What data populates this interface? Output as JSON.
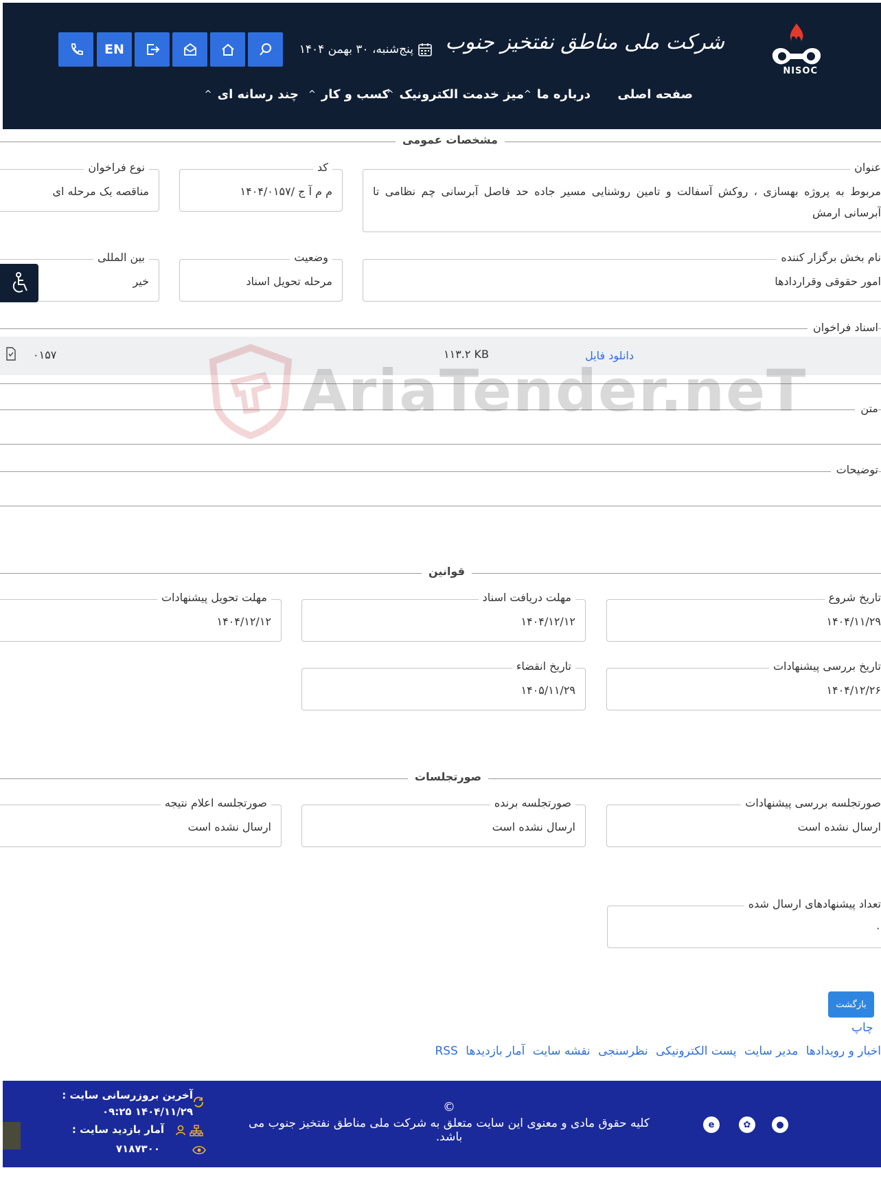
{
  "header": {
    "org_name": "شرکت ملی مناطق نفتخیز جنوب",
    "org_abbr": "NISOC",
    "date": "پنج‌شنبه، ۳۰ بهمن ۱۴۰۴",
    "lang_button": "EN",
    "nav": [
      "صفحه اصلی",
      "درباره ما",
      "میز خدمت الکترونیک",
      "کسب و کار",
      "چند رسانه ای"
    ]
  },
  "general": {
    "title": "مشخصات عمومی",
    "fields": {
      "subject_label": "عنوان",
      "subject_value": "مربوط به پروژه بهسازی ، روکش آسفالت و تامین روشنایی مسیر جاده حد فاصل آبرسانی چم نظامی تا آبرسانی ارمش",
      "code_label": "کد",
      "code_value": "م م آ ج /۱۴۰۴/۰۱۵۷",
      "type_label": "نوع فراخوان",
      "type_value": "مناقصه یک مرحله ای",
      "dept_label": "نام بخش برگزار کننده",
      "dept_value": "امور حقوقی وقراردادها",
      "status_label": "وضعیت",
      "status_value": "مرحله تحویل اسناد",
      "intl_label": "بین المللی",
      "intl_value": "خیر"
    },
    "docs_label": "اسناد فراخوان",
    "doc": {
      "link": "دانلود فایل",
      "size": "۱۱۳.۲ KB",
      "code": "۰۱۵۷"
    },
    "text_label": "متن",
    "desc_label": "توضیحات"
  },
  "watermark": "AriaTender.neT",
  "rules": {
    "title": "قوانین",
    "start_label": "تاریخ شروع",
    "start_value": "۱۴۰۴/۱۱/۲۹",
    "doc_deadline_label": "مهلت دریافت اسناد",
    "doc_deadline_value": "۱۴۰۴/۱۲/۱۲",
    "offer_deadline_label": "مهلت تحویل پیشنهادات",
    "offer_deadline_value": "۱۴۰۴/۱۲/۱۲",
    "review_label": "تاریخ بررسی پیشنهادات",
    "review_value": "۱۴۰۴/۱۲/۲۶",
    "expire_label": "تاریخ انقضاء",
    "expire_value": "۱۴۰۵/۱۱/۲۹"
  },
  "minutes": {
    "title": "صورتجلسات",
    "review_label": "صورتجلسه بررسی پیشنهادات",
    "review_value": "ارسال نشده است",
    "winner_label": "صورتجلسه برنده",
    "winner_value": "ارسال نشده است",
    "result_label": "صورتجلسه اعلام نتیجه",
    "result_value": "ارسال نشده است",
    "count_label": "تعداد پیشنهادهای ارسال شده",
    "count_value": "۰"
  },
  "actions": {
    "back": "بازگشت",
    "print": "چاپ",
    "links": [
      "اخبار و رویدادها",
      "مدیر سایت",
      "پست الکترونیکی",
      "نظرسنجی",
      "نقشه سایت",
      "آمار بازدیدها",
      "RSS"
    ]
  },
  "footer": {
    "copyright_symbol": "©",
    "copyright": "کلیه حقوق مادی و معنوی این سایت متعلق به شرکت ملی مناطق نفتخیز جنوب می باشد.",
    "last_update_label": "آخرین بروزرسانی سایت :",
    "last_update_value": "۱۴۰۴/۱۱/۲۹ ۰۹:۲۵",
    "visits_label": "آمار بازدید سایت :",
    "visits_value": "۷۱۸۷۳۰۰"
  }
}
